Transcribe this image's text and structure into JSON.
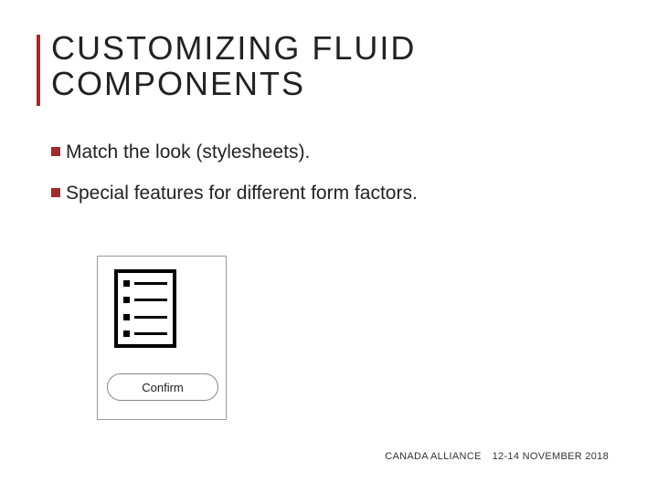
{
  "title": "CUSTOMIZING FLUID COMPONENTS",
  "bullets": [
    "Match the look (stylesheets).",
    "Special features for different form factors."
  ],
  "confirm_label": "Confirm",
  "footer_org": "CANADA ALLIANCE",
  "footer_date": "12-14 NOVEMBER 2018"
}
